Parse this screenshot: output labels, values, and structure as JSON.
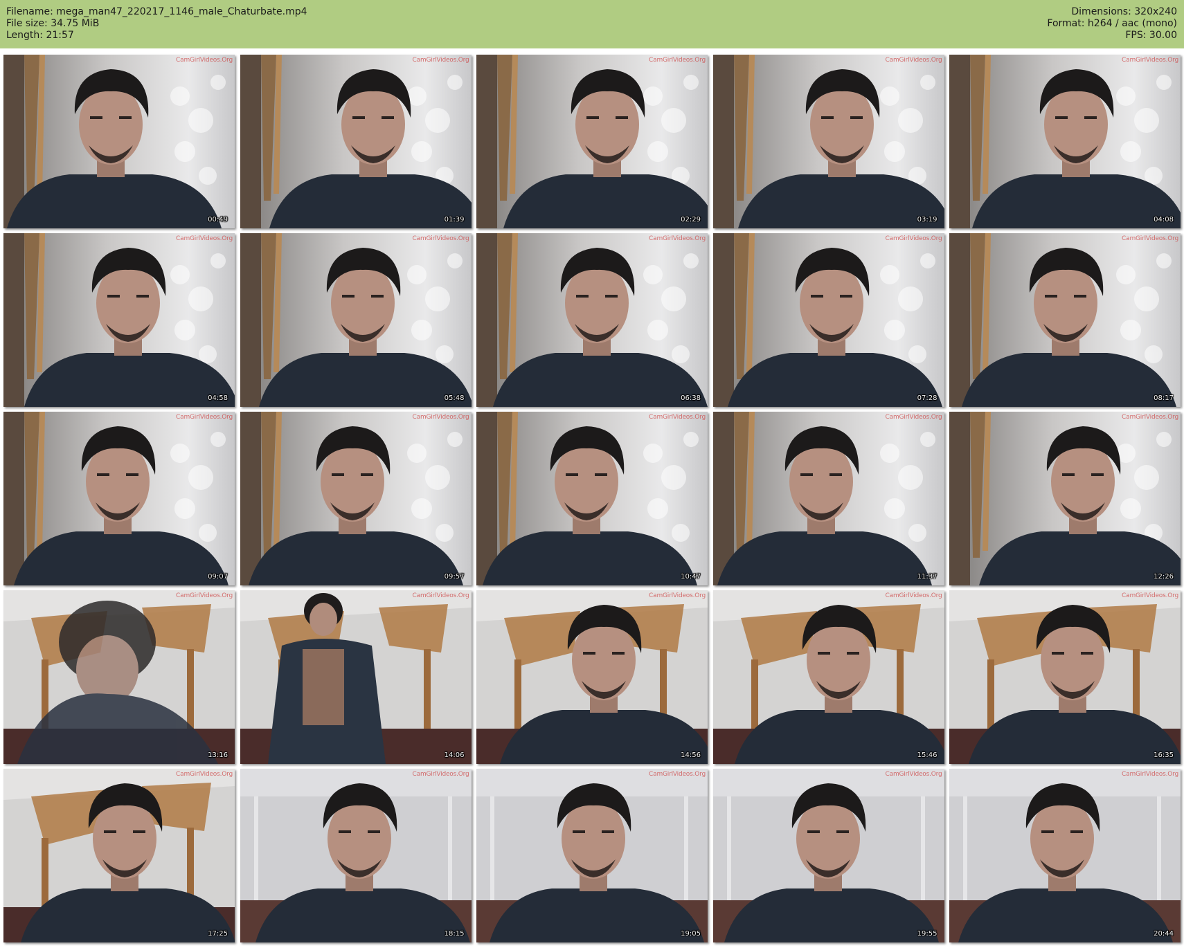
{
  "header": {
    "filename": "Filename: mega_man47_220217_1146_male_Chaturbate.mp4",
    "filesize": "File size: 34.75 MiB",
    "length": "Length: 21:57",
    "dimensions": "Dimensions: 320x240",
    "format": "Format: h264 / aac (mono)",
    "fps": "FPS: 30.00"
  },
  "watermark": "CamGirlVideos.Org",
  "colors": {
    "header_bg": "#b0cc82",
    "page_bg": "#ffffff",
    "watermark": "#cd4646"
  },
  "thumbnails": [
    {
      "timestamp": "00:49",
      "scene": "curtain"
    },
    {
      "timestamp": "01:39",
      "scene": "curtain"
    },
    {
      "timestamp": "02:29",
      "scene": "curtain"
    },
    {
      "timestamp": "03:19",
      "scene": "curtain"
    },
    {
      "timestamp": "04:08",
      "scene": "curtain"
    },
    {
      "timestamp": "04:58",
      "scene": "curtain"
    },
    {
      "timestamp": "05:48",
      "scene": "curtain"
    },
    {
      "timestamp": "06:38",
      "scene": "curtain"
    },
    {
      "timestamp": "07:28",
      "scene": "curtain"
    },
    {
      "timestamp": "08:17",
      "scene": "curtain"
    },
    {
      "timestamp": "09:07",
      "scene": "curtain"
    },
    {
      "timestamp": "09:57",
      "scene": "curtain"
    },
    {
      "timestamp": "10:47",
      "scene": "curtain"
    },
    {
      "timestamp": "11:37",
      "scene": "curtain"
    },
    {
      "timestamp": "12:26",
      "scene": "curtain"
    },
    {
      "timestamp": "13:16",
      "scene": "room-blur"
    },
    {
      "timestamp": "14:06",
      "scene": "room-standing"
    },
    {
      "timestamp": "14:56",
      "scene": "room"
    },
    {
      "timestamp": "15:46",
      "scene": "room"
    },
    {
      "timestamp": "16:35",
      "scene": "room"
    },
    {
      "timestamp": "17:25",
      "scene": "room"
    },
    {
      "timestamp": "18:15",
      "scene": "wall"
    },
    {
      "timestamp": "19:05",
      "scene": "wall"
    },
    {
      "timestamp": "19:55",
      "scene": "wall"
    },
    {
      "timestamp": "20:44",
      "scene": "wall"
    }
  ]
}
